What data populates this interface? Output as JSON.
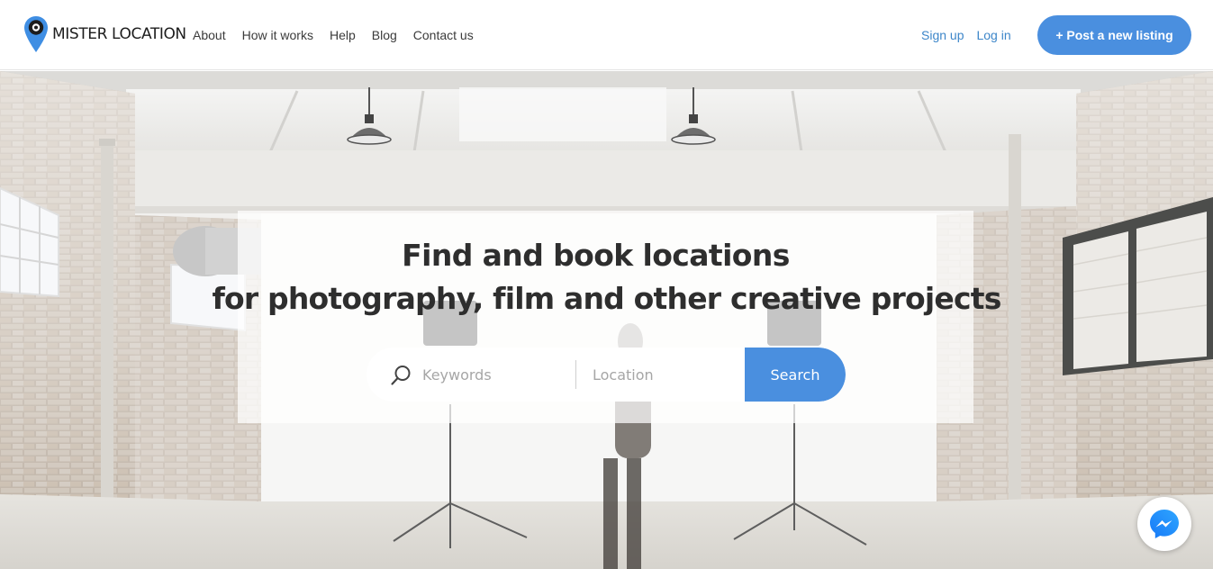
{
  "brand": {
    "name_part1": "MISTER",
    "name_part2": "LOCATION",
    "logo_icon": "map-pin-icon"
  },
  "nav": {
    "items": [
      {
        "label": "About"
      },
      {
        "label": "How it works"
      },
      {
        "label": "Help"
      },
      {
        "label": "Blog"
      },
      {
        "label": "Contact us"
      }
    ]
  },
  "auth": {
    "signup": "Sign up",
    "login": "Log in"
  },
  "cta": {
    "post_listing": "+ Post a new listing"
  },
  "hero": {
    "headline_line1": "Find and book locations",
    "headline_line2": "for photography, film and other creative projects"
  },
  "search": {
    "keywords_placeholder": "Keywords",
    "location_placeholder": "Location",
    "button_label": "Search",
    "icon": "search-icon"
  },
  "chat": {
    "icon": "messenger-icon"
  },
  "colors": {
    "accent": "#4a8fdf",
    "link": "#3d86c9",
    "headline": "#2e2e2e"
  }
}
